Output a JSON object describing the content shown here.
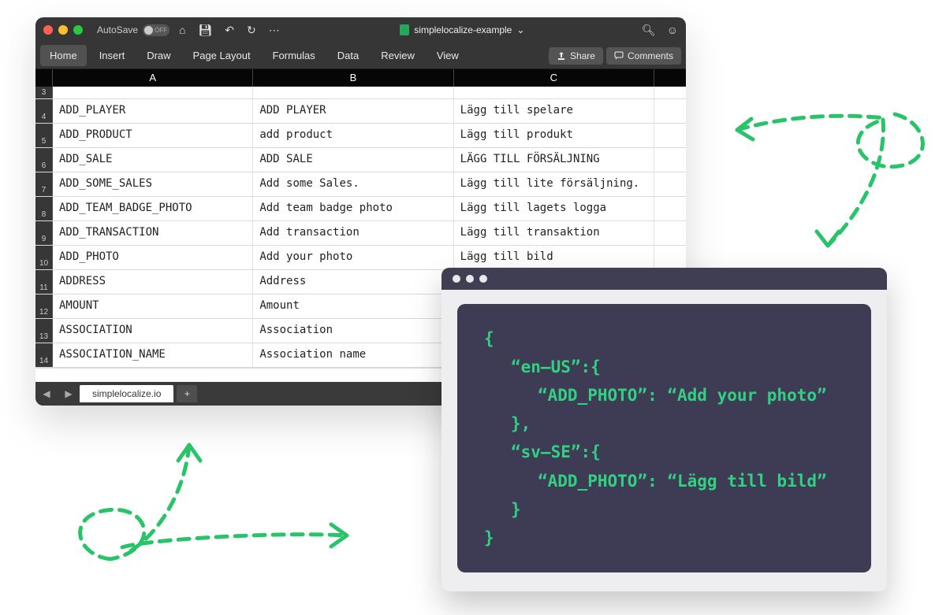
{
  "titlebar": {
    "autosave_label": "AutoSave",
    "autosave_state": "OFF",
    "doc_name": "simplelocalize-example",
    "doc_caret": "⌄"
  },
  "ribbon": {
    "tabs": [
      "Home",
      "Insert",
      "Draw",
      "Page Layout",
      "Formulas",
      "Data",
      "Review",
      "View"
    ],
    "active_index": 0,
    "share_label": "Share",
    "comments_label": "Comments"
  },
  "columns": [
    "A",
    "B",
    "C"
  ],
  "first_visible_rownum": 3,
  "rows": [
    {
      "n": 4,
      "a": "ADD_PLAYER",
      "b": "ADD PLAYER",
      "c": "Lägg till spelare"
    },
    {
      "n": 5,
      "a": "ADD_PRODUCT",
      "b": "add product",
      "c": "Lägg till produkt"
    },
    {
      "n": 6,
      "a": "ADD_SALE",
      "b": "ADD SALE",
      "c": "LÄGG TILL FÖRSÄLJNING"
    },
    {
      "n": 7,
      "a": "ADD_SOME_SALES",
      "b": "Add some Sales.",
      "c": "Lägg till lite försäljning."
    },
    {
      "n": 8,
      "a": "ADD_TEAM_BADGE_PHOTO",
      "b": "Add team badge photo",
      "c": "Lägg till lagets logga"
    },
    {
      "n": 9,
      "a": "ADD_TRANSACTION",
      "b": "Add transaction",
      "c": "Lägg till transaktion"
    },
    {
      "n": 10,
      "a": "ADD_PHOTO",
      "b": "Add your photo",
      "c": "Lägg till bild"
    },
    {
      "n": 11,
      "a": "ADDRESS",
      "b": "Address",
      "c": ""
    },
    {
      "n": 12,
      "a": "AMOUNT",
      "b": "Amount",
      "c": ""
    },
    {
      "n": 13,
      "a": "ASSOCIATION",
      "b": "Association",
      "c": ""
    },
    {
      "n": 14,
      "a": "ASSOCIATION_NAME",
      "b": "Association name",
      "c": ""
    }
  ],
  "sheet_tab": "simplelocalize.io",
  "code": {
    "lines": [
      {
        "indent": 0,
        "text": "{"
      },
      {
        "indent": 1,
        "text": "“en–US”:{"
      },
      {
        "indent": 2,
        "text": "“ADD_PHOTO”: “Add your photo”"
      },
      {
        "indent": 1,
        "text": "},"
      },
      {
        "indent": 1,
        "text": "“sv–SE”:{"
      },
      {
        "indent": 2,
        "text": "“ADD_PHOTO”: “Lägg till bild”"
      },
      {
        "indent": 1,
        "text": "}"
      },
      {
        "indent": 0,
        "text": "}"
      }
    ]
  }
}
